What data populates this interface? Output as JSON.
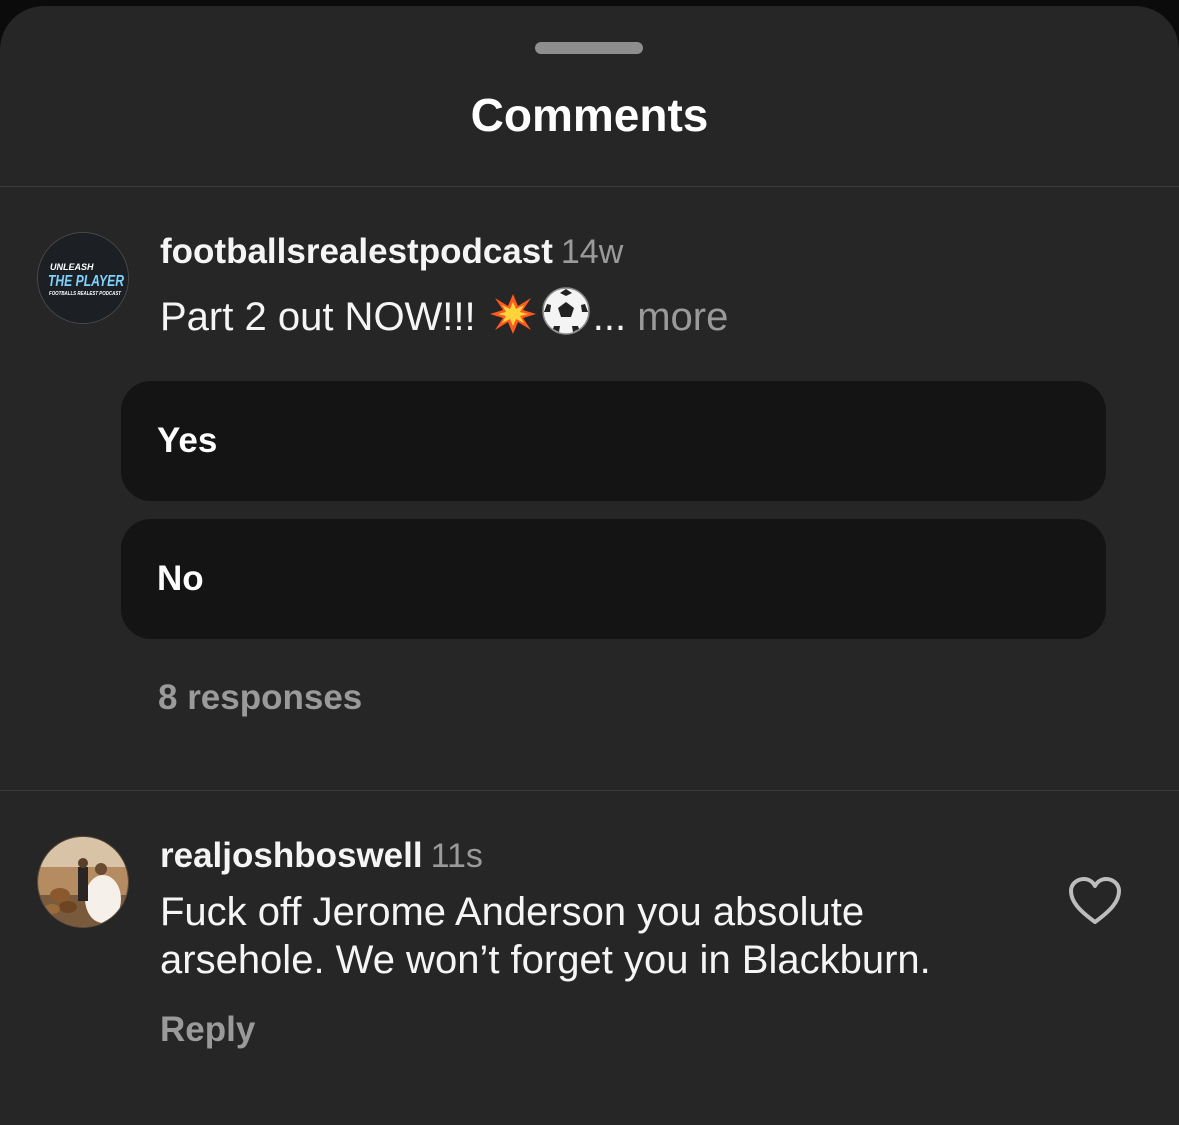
{
  "sheet": {
    "title": "Comments"
  },
  "comments": [
    {
      "username": "footballsrealestpodcast",
      "time": "14w",
      "text_before": "Part 2 out NOW!!! ",
      "emojis": [
        "collision-emoji",
        "soccer-ball-emoji"
      ],
      "text_after": "...",
      "more_label": " more",
      "avatar": {
        "line1": "UNLEASH",
        "line2": "THE PLAYER",
        "line3": "FOOTBALLS REALEST PODCAST",
        "accent": "#7fd3ff"
      },
      "poll": {
        "options": [
          "Yes",
          "No"
        ],
        "responses": "8 responses"
      }
    },
    {
      "username": "realjoshboswell",
      "time": "11s",
      "text_line1": "Fuck off Jerome Anderson you absolute",
      "text_line2": "arsehole. We won’t forget you in Blackburn.",
      "reply_label": "Reply",
      "like_icon": "heart-outline-icon"
    }
  ],
  "colors": {
    "sheet_bg": "#262626",
    "poll_bg": "#141414",
    "muted_text": "#9a9a9a"
  }
}
